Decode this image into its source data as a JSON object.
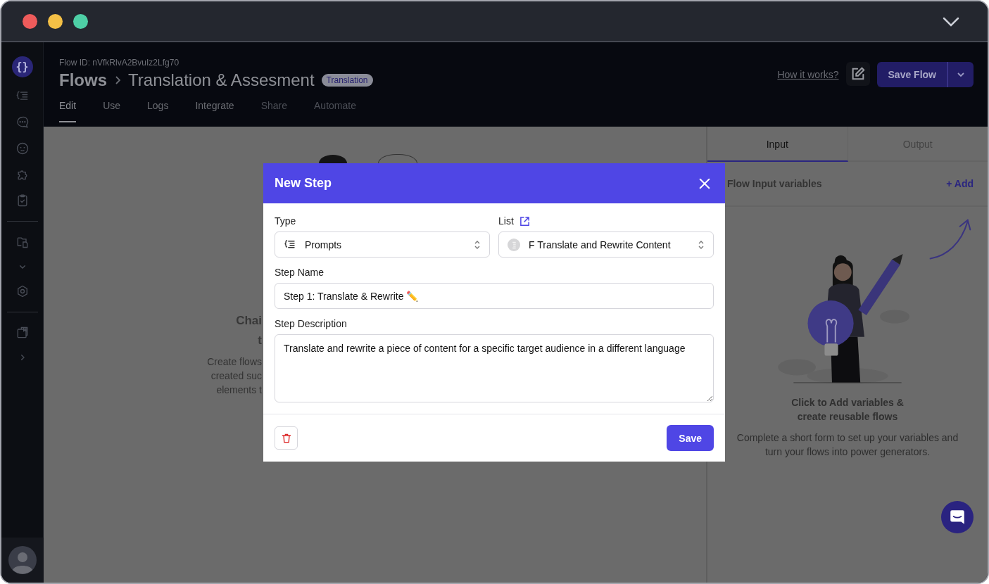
{
  "window": {
    "logo": "{}"
  },
  "header": {
    "flow_id": "Flow ID: nVfkRlvA2BvuIz2Lfg70",
    "breadcrumb": [
      "Flows",
      "Translation & Assesment"
    ],
    "badge": "Translation",
    "help_link": "How it works?",
    "save_button": "Save Flow",
    "tabs": [
      {
        "label": "Edit",
        "selected": true,
        "disabled": false
      },
      {
        "label": "Use",
        "selected": false,
        "disabled": false
      },
      {
        "label": "Logs",
        "selected": false,
        "disabled": false
      },
      {
        "label": "Integrate",
        "selected": false,
        "disabled": false
      },
      {
        "label": "Share",
        "selected": false,
        "disabled": true
      },
      {
        "label": "Automate",
        "selected": false,
        "disabled": true
      }
    ]
  },
  "canvas": {
    "heading_lines": [
      "Chai",
      "t"
    ],
    "text_lines": [
      "Create flows",
      "created suc",
      "elements t"
    ]
  },
  "panel": {
    "tabs": [
      {
        "label": "Input",
        "selected": true
      },
      {
        "label": "Output",
        "selected": false
      }
    ],
    "section_title": "Flow Input variables",
    "add_link": "+ Add",
    "empty_title": "Click to Add variables & create reusable flows",
    "empty_text": "Complete a short form to set up your variables and turn your flows into power generators."
  },
  "modal": {
    "title": "New Step",
    "type": {
      "label": "Type",
      "value": "Prompts"
    },
    "list": {
      "label": "List",
      "value": "F Translate and Rewrite Content"
    },
    "step_name": {
      "label": "Step Name",
      "value": "Step 1: Translate & Rewrite ✏️"
    },
    "step_description": {
      "label": "Step Description",
      "value": "Translate and rewrite a piece of content for a specific target audience in a different language"
    },
    "save_button": "Save"
  }
}
